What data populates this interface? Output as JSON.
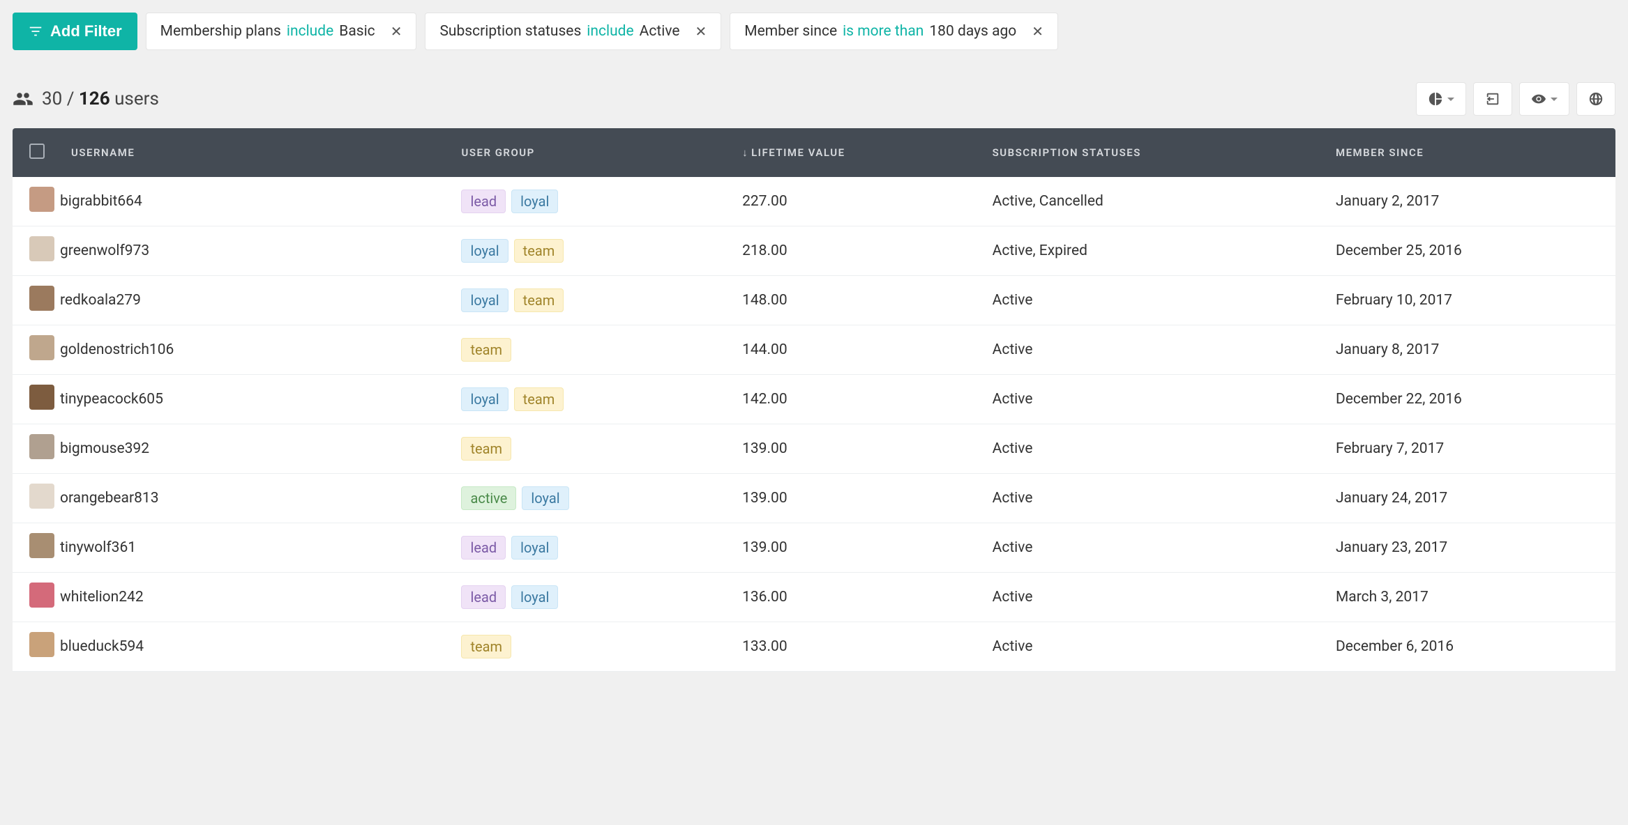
{
  "add_filter_label": "Add Filter",
  "filters": [
    {
      "field": "Membership plans",
      "op": "include",
      "value": "Basic"
    },
    {
      "field": "Subscription statuses",
      "op": "include",
      "value": "Active"
    },
    {
      "field": "Member since",
      "op": "is more than",
      "value": "180 days ago"
    }
  ],
  "count": {
    "shown": "30",
    "sep": "/",
    "total": "126",
    "unit": "users"
  },
  "columns": {
    "username": "USERNAME",
    "user_group": "USER GROUP",
    "lifetime_value": "LIFETIME VALUE",
    "lifetime_value_sort": "↓",
    "subscription_statuses": "SUBSCRIPTION STATUSES",
    "member_since": "MEMBER SINCE"
  },
  "avatar_colors": [
    "#c59b83",
    "#d8c9b8",
    "#9b7a5e",
    "#bfa78d",
    "#7d5c3f",
    "#b0a090",
    "#e3d9cd",
    "#a88e72",
    "#d46a7a",
    "#c9a27a"
  ],
  "rows": [
    {
      "username": "bigrabbit664",
      "groups": [
        "lead",
        "loyal"
      ],
      "ltv": "227.00",
      "status": "Active, Cancelled",
      "member_since": "January 2, 2017"
    },
    {
      "username": "greenwolf973",
      "groups": [
        "loyal",
        "team"
      ],
      "ltv": "218.00",
      "status": "Active, Expired",
      "member_since": "December 25, 2016"
    },
    {
      "username": "redkoala279",
      "groups": [
        "loyal",
        "team"
      ],
      "ltv": "148.00",
      "status": "Active",
      "member_since": "February 10, 2017"
    },
    {
      "username": "goldenostrich106",
      "groups": [
        "team"
      ],
      "ltv": "144.00",
      "status": "Active",
      "member_since": "January 8, 2017"
    },
    {
      "username": "tinypeacock605",
      "groups": [
        "loyal",
        "team"
      ],
      "ltv": "142.00",
      "status": "Active",
      "member_since": "December 22, 2016"
    },
    {
      "username": "bigmouse392",
      "groups": [
        "team"
      ],
      "ltv": "139.00",
      "status": "Active",
      "member_since": "February 7, 2017"
    },
    {
      "username": "orangebear813",
      "groups": [
        "active",
        "loyal"
      ],
      "ltv": "139.00",
      "status": "Active",
      "member_since": "January 24, 2017"
    },
    {
      "username": "tinywolf361",
      "groups": [
        "lead",
        "loyal"
      ],
      "ltv": "139.00",
      "status": "Active",
      "member_since": "January 23, 2017"
    },
    {
      "username": "whitelion242",
      "groups": [
        "lead",
        "loyal"
      ],
      "ltv": "136.00",
      "status": "Active",
      "member_since": "March 3, 2017"
    },
    {
      "username": "blueduck594",
      "groups": [
        "team"
      ],
      "ltv": "133.00",
      "status": "Active",
      "member_since": "December 6, 2016"
    }
  ]
}
